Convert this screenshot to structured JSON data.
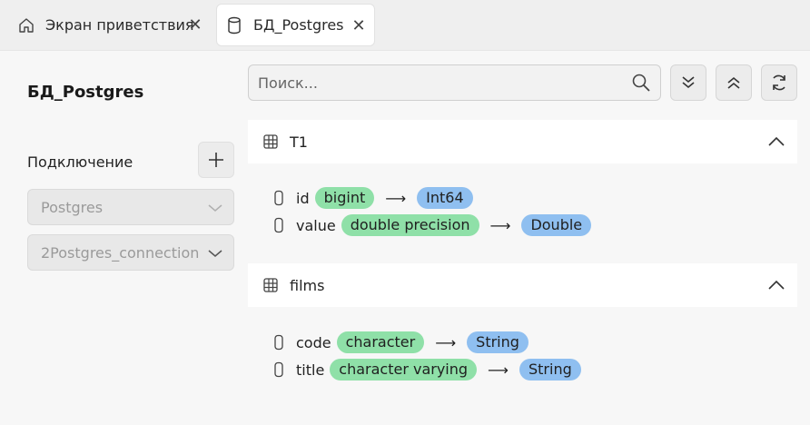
{
  "tabs": [
    {
      "label": "Экран приветствия",
      "icon": "home-icon"
    },
    {
      "label": "БД_Postgres",
      "icon": "database-icon",
      "active": true
    }
  ],
  "sidebar": {
    "title": "БД_Postgres",
    "connection_label": "Подключение",
    "db_type": "Postgres",
    "connection": "2Postgres_connection"
  },
  "search": {
    "placeholder": "Поиск..."
  },
  "tables": [
    {
      "name": "T1",
      "columns": [
        {
          "name": "id",
          "source_type": "bigint",
          "target_type": "Int64"
        },
        {
          "name": "value",
          "source_type": "double precision",
          "target_type": "Double"
        }
      ]
    },
    {
      "name": "films",
      "columns": [
        {
          "name": "code",
          "source_type": "character",
          "target_type": "String"
        },
        {
          "name": "title",
          "source_type": "character varying",
          "target_type": "String"
        }
      ]
    }
  ],
  "arrow": "⟶",
  "colors": {
    "source_pill": "#8fe0a8",
    "target_pill": "#8fbff0"
  }
}
